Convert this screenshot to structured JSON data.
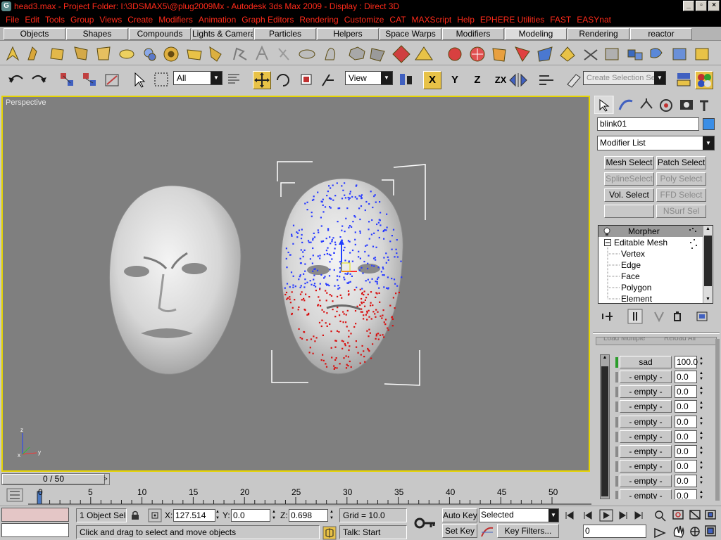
{
  "window": {
    "title": "head3.max     - Project Folder: I:\\3DSMAX5\\@plug2009Mx     - Autodesk 3ds Max  2009        - Display : Direct 3D",
    "app_icon_letter": "G",
    "controls": [
      "_",
      "▫",
      "×"
    ]
  },
  "menu": [
    "File",
    "Edit",
    "Tools",
    "Group",
    "Views",
    "Create",
    "Modifiers",
    "Animation",
    "Graph Editors",
    "Rendering",
    "Customize",
    "CAT",
    "MAXScript",
    "Help",
    "EPHERE Utilities",
    "FAST",
    "EASYnat"
  ],
  "command_tabs": [
    "Objects",
    "Shapes",
    "Compounds",
    "Lights & Cameras",
    "Particles",
    "Helpers",
    "Space Warps",
    "Modifiers",
    "Modeling",
    "Rendering",
    "reactor"
  ],
  "active_tab": "Modeling",
  "main_toolbar": {
    "selection_filter": "All",
    "reference_coord": "View",
    "axis_x": "X",
    "axis_y": "Y",
    "axis_z": "Z",
    "axis_zx": "ZX",
    "selection_set_placeholder": "Create Selection Set"
  },
  "viewport": {
    "label": "Perspective",
    "gizmo_z": "z",
    "axis_z": "z",
    "axis_x": "x",
    "axis_y": "y"
  },
  "command_panel": {
    "object_name": "blink01",
    "object_color": "#3b8ee6",
    "modifier_list": "Modifier List",
    "modifier_buttons": [
      {
        "label": "Mesh Select",
        "enabled": true
      },
      {
        "label": "Patch Select",
        "enabled": true
      },
      {
        "label": "SplineSelect",
        "enabled": false
      },
      {
        "label": "Poly Select",
        "enabled": false
      },
      {
        "label": "Vol. Select",
        "enabled": true
      },
      {
        "label": "FFD Select",
        "enabled": false
      },
      {
        "label": "",
        "enabled": false
      },
      {
        "label": "NSurf Sel",
        "enabled": false
      }
    ],
    "stack": [
      {
        "label": "Morpher",
        "level": 0,
        "selected": true
      },
      {
        "label": "Editable Mesh",
        "level": 0,
        "selected": false
      },
      {
        "label": "Vertex",
        "level": 1,
        "selected": false
      },
      {
        "label": "Edge",
        "level": 1,
        "selected": false
      },
      {
        "label": "Face",
        "level": 1,
        "selected": false
      },
      {
        "label": "Polygon",
        "level": 1,
        "selected": false
      },
      {
        "label": "Element",
        "level": 1,
        "selected": false
      }
    ],
    "rollout_partial": [
      "Load Multiple",
      "Reload All"
    ],
    "channels": [
      {
        "name": "sad",
        "value": "100.0",
        "active": true
      },
      {
        "name": "- empty -",
        "value": "0.0",
        "active": false
      },
      {
        "name": "- empty -",
        "value": "0.0",
        "active": false
      },
      {
        "name": "- empty -",
        "value": "0.0",
        "active": false
      },
      {
        "name": "- empty -",
        "value": "0.0",
        "active": false
      },
      {
        "name": "- empty -",
        "value": "0.0",
        "active": false
      },
      {
        "name": "- empty -",
        "value": "0.0",
        "active": false
      },
      {
        "name": "- empty -",
        "value": "0.0",
        "active": false
      },
      {
        "name": "- empty -",
        "value": "0.0",
        "active": false
      },
      {
        "name": "- empty -",
        "value": "0.0",
        "active": false
      }
    ]
  },
  "timeline": {
    "slider_label": "0 / 50",
    "next_arrow": ">",
    "ticks": [
      "0",
      "5",
      "10",
      "15",
      "20",
      "25",
      "30",
      "35",
      "40",
      "45",
      "50"
    ]
  },
  "status": {
    "selection_info": "1 Object Sele",
    "x_label": "X:",
    "x_value": "127.514",
    "y_label": "Y:",
    "y_value": "0.0",
    "z_label": "Z:",
    "z_value": "0.698",
    "grid": "Grid = 10.0",
    "prompt": "Click and drag to select and move objects",
    "talk": "Talk: Start",
    "auto_key": "Auto Key",
    "set_key": "Set Key",
    "key_mode": "Selected",
    "key_filters": "Key Filters...",
    "current_frame": "0"
  }
}
